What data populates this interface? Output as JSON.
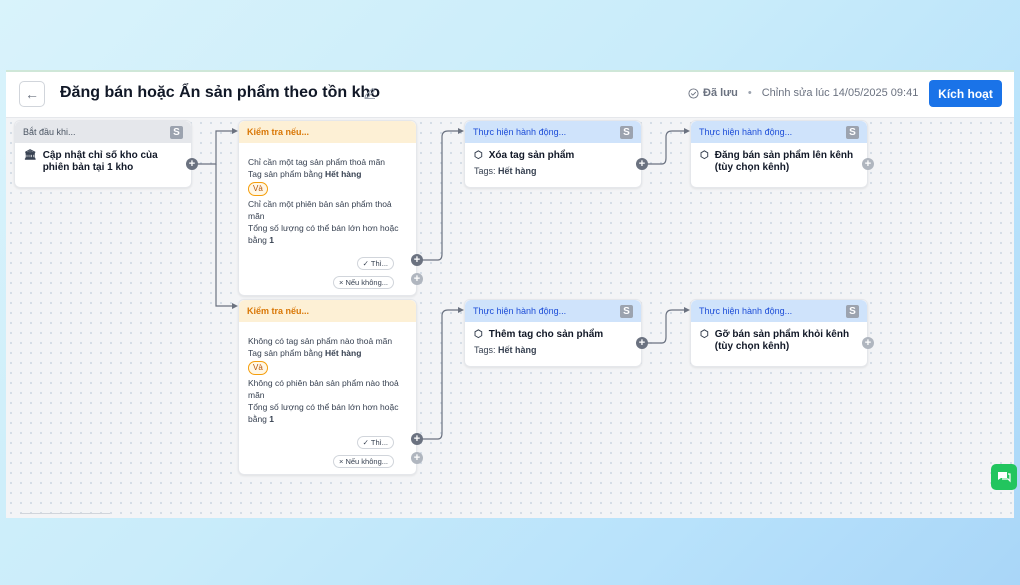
{
  "header": {
    "title": "Đăng bán hoặc Ẩn sản phẩm theo tồn kho",
    "saved_label": "Đã lưu",
    "edited_label": "Chỉnh sửa lúc 14/05/2025 09:41",
    "activate_label": "Kích hoạt"
  },
  "nodes": {
    "start": {
      "head": "Bắt đầu khi...",
      "title": "Cập nhật chỉ số kho của phiên bản tại 1 kho"
    },
    "cond1": {
      "head": "Kiểm tra nếu...",
      "line1": "Chỉ cần một tag sản phẩm thoả mãn",
      "line2_prefix": "Tag sản phẩm bằng ",
      "line2_value": "Hết hàng",
      "and": "Và",
      "line3": "Chỉ cần một phiên bản sản phẩm thoả mãn",
      "line4_prefix": "Tổng số lượng có thể bán lớn hơn hoặc bằng ",
      "line4_value": "1",
      "yes": "✓ Thì...",
      "no": "× Nếu không..."
    },
    "cond2": {
      "head": "Kiểm tra nếu...",
      "line1": "Không có tag sản phẩm nào thoả mãn",
      "line2_prefix": "Tag sản phẩm bằng ",
      "line2_value": "Hết hàng",
      "and": "Và",
      "line3": "Không có phiên bản sản phẩm nào thoả mãn",
      "line4_prefix": "Tổng số lượng có thể bán lớn hơn hoặc bằng ",
      "line4_value": "1",
      "yes": "✓ Thì...",
      "no": "× Nếu không..."
    },
    "act1": {
      "head": "Thực hiện hành động...",
      "title": "Xóa tag sản phẩm",
      "tags_label": "Tags:",
      "tags_value": "Hết hàng"
    },
    "act2": {
      "head": "Thực hiện hành động...",
      "title": "Đăng bán sản phẩm lên kênh (tùy chọn kênh)"
    },
    "act3": {
      "head": "Thực hiện hành động...",
      "title": "Thêm tag cho sản phẩm",
      "tags_label": "Tags:",
      "tags_value": "Hết hàng"
    },
    "act4": {
      "head": "Thực hiện hành động...",
      "title": "Gỡ bán sản phẩm khỏi kênh (tùy chọn kênh)"
    }
  },
  "badge_letter": "S",
  "colors": {
    "primary": "#1a73e8",
    "condition_head": "#fdf0d5",
    "action_head": "#cfe3fb",
    "start_head": "#e5e7eb"
  }
}
